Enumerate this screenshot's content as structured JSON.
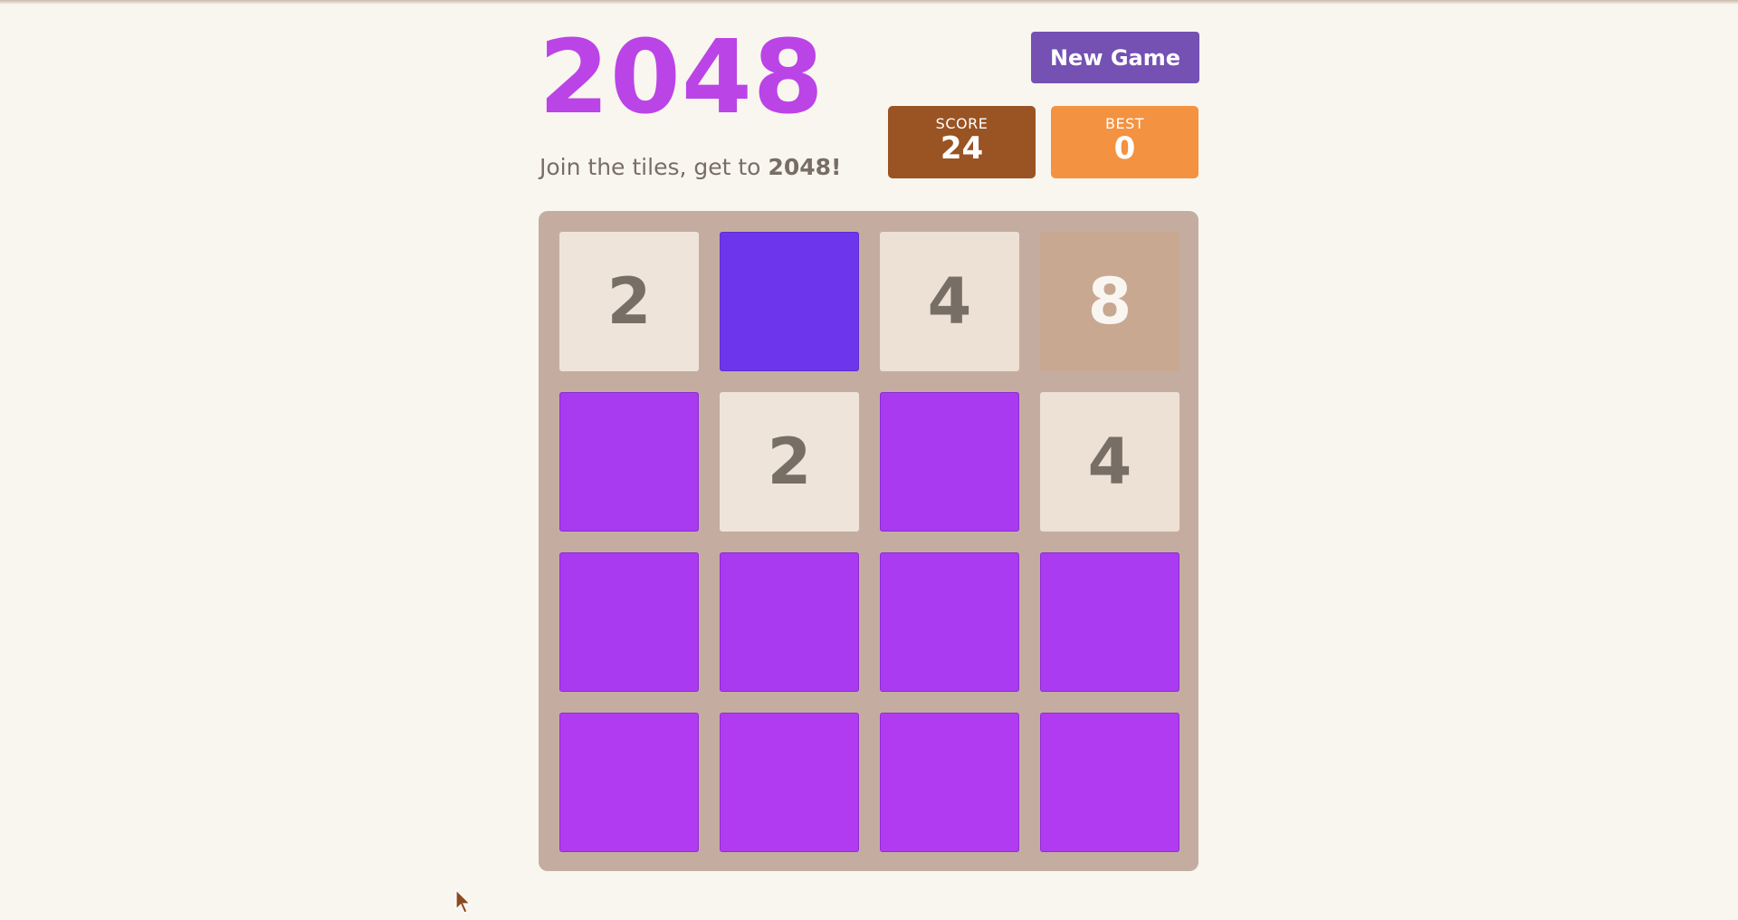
{
  "app": {
    "title": "2048",
    "tagline_prefix": "Join the tiles, get to ",
    "tagline_bold": "2048!"
  },
  "controls": {
    "new_game_label": "New Game"
  },
  "scores": {
    "score_label": "SCORE",
    "score_value": "24",
    "best_label": "BEST",
    "best_value": "0"
  },
  "colors": {
    "title": "#bb44e6",
    "board": "#c4ada0",
    "new_game": "#7451b2",
    "score_box": "#9a5323",
    "best_box": "#f39241"
  },
  "board": {
    "rows": [
      [
        {
          "value": "2",
          "bg": "#eee4da",
          "fg": "#776e65"
        },
        {
          "value": "",
          "bg": "#6d36ec",
          "fg": "#776e65"
        },
        {
          "value": "4",
          "bg": "#ede0d4",
          "fg": "#776e65"
        },
        {
          "value": "8",
          "bg": "#c9a891",
          "fg": "#f9f6f2"
        }
      ],
      [
        {
          "value": "",
          "bg": "#a83af0",
          "fg": "#776e65"
        },
        {
          "value": "2",
          "bg": "#eee4da",
          "fg": "#776e65"
        },
        {
          "value": "",
          "bg": "#a93af0",
          "fg": "#776e65"
        },
        {
          "value": "4",
          "bg": "#ede0d4",
          "fg": "#776e65"
        }
      ],
      [
        {
          "value": "",
          "bg": "#a93af0",
          "fg": "#776e65"
        },
        {
          "value": "",
          "bg": "#a93af0",
          "fg": "#776e65"
        },
        {
          "value": "",
          "bg": "#aa3bf0",
          "fg": "#776e65"
        },
        {
          "value": "",
          "bg": "#aa3bf0",
          "fg": "#776e65"
        }
      ],
      [
        {
          "value": "",
          "bg": "#b13bf0",
          "fg": "#776e65"
        },
        {
          "value": "",
          "bg": "#b13bf0",
          "fg": "#776e65"
        },
        {
          "value": "",
          "bg": "#b13bf0",
          "fg": "#776e65"
        },
        {
          "value": "",
          "bg": "#b13bf0",
          "fg": "#776e65"
        }
      ]
    ]
  }
}
